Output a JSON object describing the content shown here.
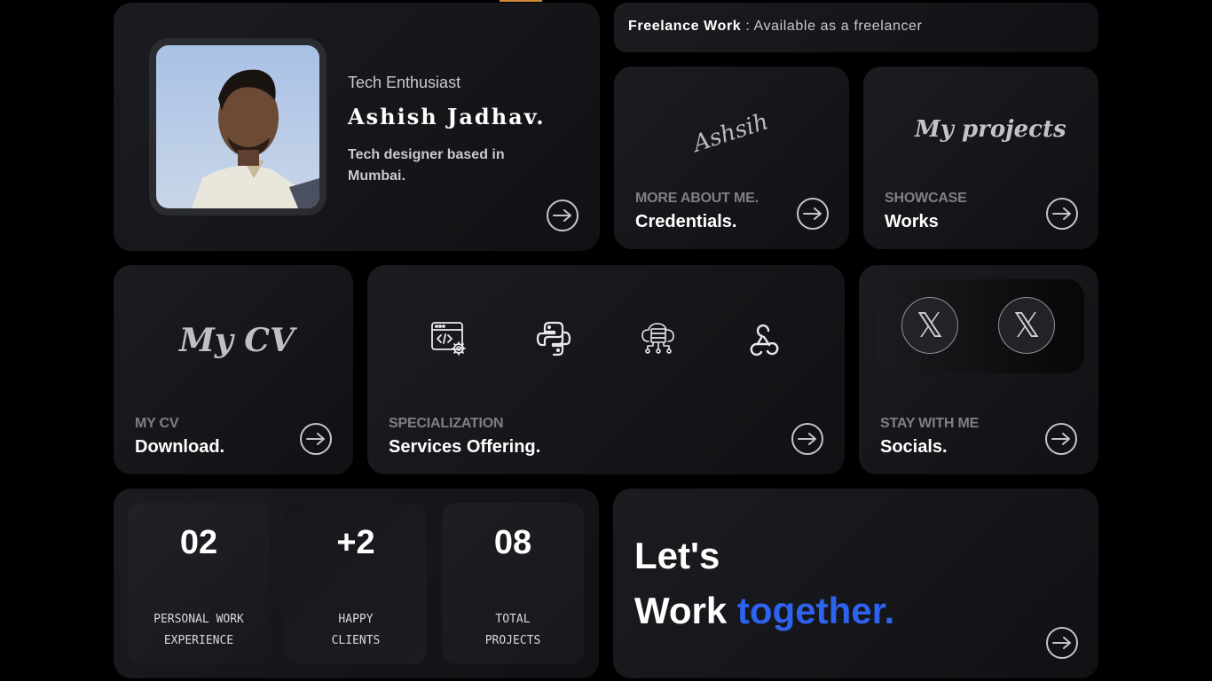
{
  "profile": {
    "tagline": "Tech Enthusiast",
    "name": "Ashish Jadhav.",
    "bio": "Tech designer based in Mumbai."
  },
  "freelance": {
    "label": "Freelance Work",
    "separator": " : ",
    "status": "Available as a freelancer"
  },
  "credentials": {
    "signature": "Ashsih",
    "eyebrow": "MORE ABOUT ME.",
    "title": "Credentials."
  },
  "works": {
    "script": "My projects",
    "eyebrow": "SHOWCASE",
    "title": "Works"
  },
  "cv": {
    "script": "My CV",
    "eyebrow": "MY CV",
    "title": "Download."
  },
  "services": {
    "eyebrow": "SPECIALIZATION",
    "title": "Services Offering.",
    "icons": [
      "web-dev-icon",
      "python-icon",
      "cloud-server-icon",
      "webhook-icon"
    ]
  },
  "socials": {
    "eyebrow": "STAY WITH ME",
    "title": "Socials.",
    "icons": [
      "x-icon",
      "x-icon"
    ],
    "glyph": "𝕏"
  },
  "stats": [
    {
      "value": "02",
      "label": "PERSONAL WORK\nEXPERIENCE"
    },
    {
      "value": "+2",
      "label": "HAPPY\nCLIENTS"
    },
    {
      "value": "08",
      "label": "TOTAL\nPROJECTS"
    }
  ],
  "cta": {
    "line1": "Let's",
    "line2_a": "Work",
    "line2_b": "together."
  },
  "colors": {
    "background": "#000000",
    "card": "#17181b",
    "accent_blue": "#2e62f0",
    "muted": "#7f8085"
  }
}
